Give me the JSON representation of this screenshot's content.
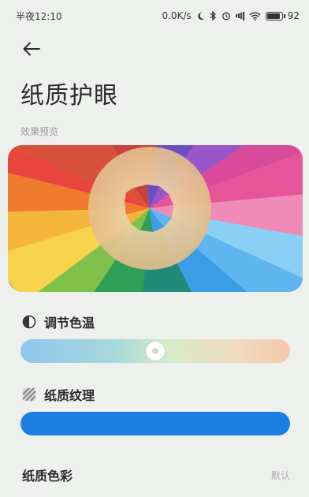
{
  "status_bar": {
    "time": "半夜12:10",
    "net_speed": "0.0K/s",
    "signal_label": "4G",
    "battery": "92"
  },
  "page": {
    "title": "纸质护眼",
    "preview_caption": "效果预览"
  },
  "color_temperature": {
    "label": "调节色温",
    "thumb_position": 0.5
  },
  "paper_texture": {
    "label": "纸质纹理",
    "level": 1.0
  },
  "paper_color": {
    "label": "纸质色彩",
    "value": "默认"
  },
  "colors": {
    "accent": "#1a7fe0"
  }
}
